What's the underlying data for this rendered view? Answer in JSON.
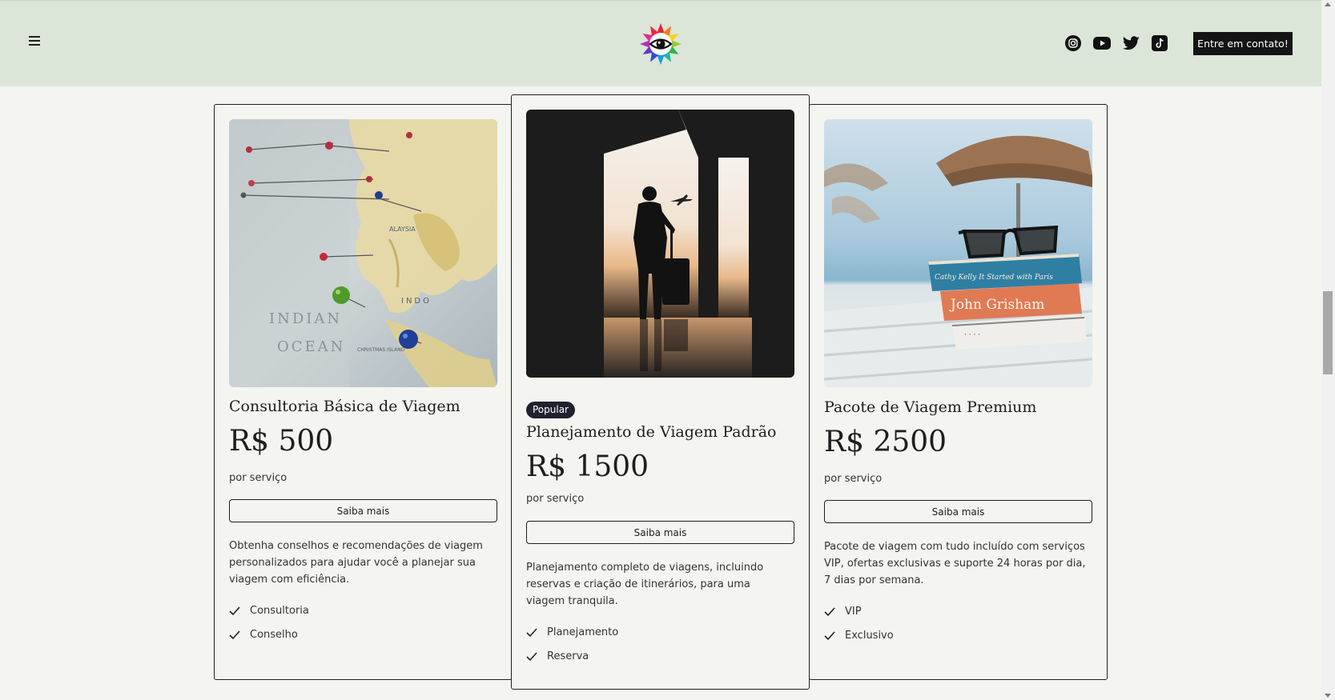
{
  "header": {
    "menu_icon": "hamburger-icon",
    "logo_icon": "eye-flower-logo",
    "socials": [
      "instagram-icon",
      "youtube-icon",
      "twitter-icon",
      "tiktok-icon"
    ],
    "cta_label": "Entre em contato!"
  },
  "cards": [
    {
      "image": "world-map-with-pins",
      "badge": "",
      "title": "Consultoria Básica de Viagem",
      "price": "R$ 500",
      "unit": "por serviço",
      "button": "Saiba mais",
      "description": "Obtenha conselhos e recomendações de viagem personalizados para ajudar você a planejar sua viagem com eficiência.",
      "features": [
        "Consultoria",
        "Conselho"
      ]
    },
    {
      "image": "traveler-silhouette-airport",
      "badge": "Popular",
      "title": "Planejamento de Viagem Padrão",
      "price": "R$ 1500",
      "unit": "por serviço",
      "button": "Saiba mais",
      "description": "Planejamento completo de viagens, incluindo reservas e criação de itinerários, para uma viagem tranquila.",
      "features": [
        "Planejamento",
        "Reserva"
      ]
    },
    {
      "image": "sunglasses-books-beach",
      "badge": "",
      "title": "Pacote de Viagem Premium",
      "price": "R$ 2500",
      "unit": "por serviço",
      "button": "Saiba mais",
      "description": "Pacote de viagem com tudo incluído com serviços VIP, ofertas exclusivas e suporte 24 horas por dia, 7 dias por semana.",
      "features": [
        "VIP",
        "Exclusivo"
      ]
    }
  ],
  "colors": {
    "header_bg": "#dbe6d8",
    "page_bg": "#f4f4f1",
    "cta_bg": "#141414",
    "badge_bg": "#1f2130"
  }
}
